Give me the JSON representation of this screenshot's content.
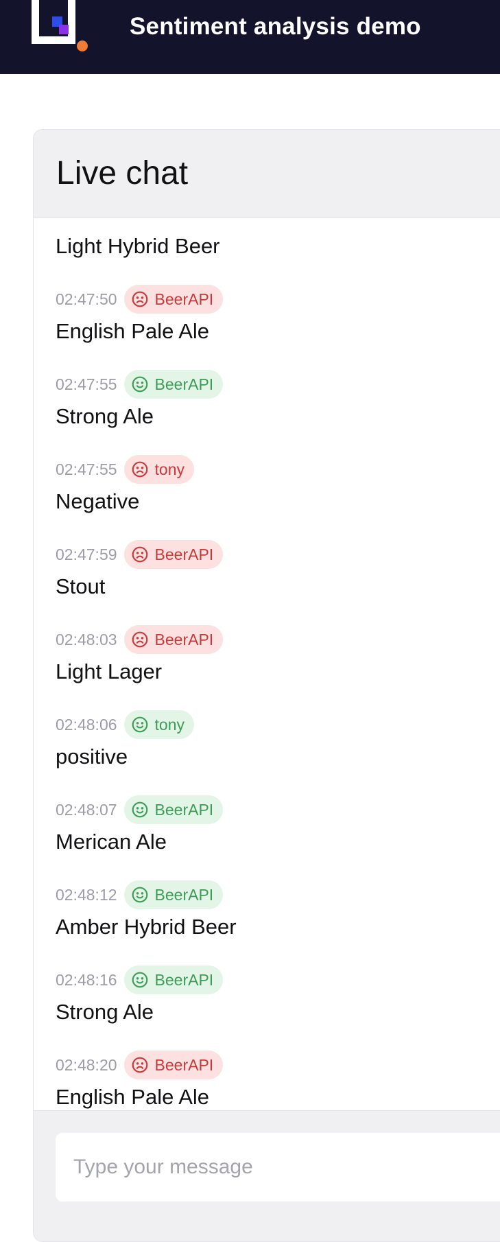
{
  "app": {
    "title": "Sentiment analysis demo"
  },
  "chat": {
    "title": "Live chat",
    "partial_top_message": "Light Hybrid Beer",
    "messages": [
      {
        "time": "02:47:50",
        "user": "BeerAPI",
        "sentiment": "negative",
        "text": "English Pale Ale"
      },
      {
        "time": "02:47:55",
        "user": "BeerAPI",
        "sentiment": "positive",
        "text": "Strong Ale"
      },
      {
        "time": "02:47:55",
        "user": "tony",
        "sentiment": "negative",
        "text": "Negative"
      },
      {
        "time": "02:47:59",
        "user": "BeerAPI",
        "sentiment": "negative",
        "text": "Stout"
      },
      {
        "time": "02:48:03",
        "user": "BeerAPI",
        "sentiment": "negative",
        "text": "Light Lager"
      },
      {
        "time": "02:48:06",
        "user": "tony",
        "sentiment": "positive",
        "text": "positive"
      },
      {
        "time": "02:48:07",
        "user": "BeerAPI",
        "sentiment": "positive",
        "text": "Merican Ale"
      },
      {
        "time": "02:48:12",
        "user": "BeerAPI",
        "sentiment": "positive",
        "text": "Amber Hybrid Beer"
      },
      {
        "time": "02:48:16",
        "user": "BeerAPI",
        "sentiment": "positive",
        "text": "Strong Ale"
      },
      {
        "time": "02:48:20",
        "user": "BeerAPI",
        "sentiment": "negative",
        "text": "English Pale Ale"
      }
    ],
    "input": {
      "placeholder": "Type your message",
      "value": ""
    }
  },
  "colors": {
    "header_bg": "#13132c",
    "negative_badge_bg": "#fde0e0",
    "negative_badge_text": "#c53b3b",
    "positive_badge_bg": "#e3f5e6",
    "positive_badge_text": "#3d9c57"
  },
  "icons": {
    "negative": "sad-face-icon",
    "positive": "smiley-face-icon"
  }
}
